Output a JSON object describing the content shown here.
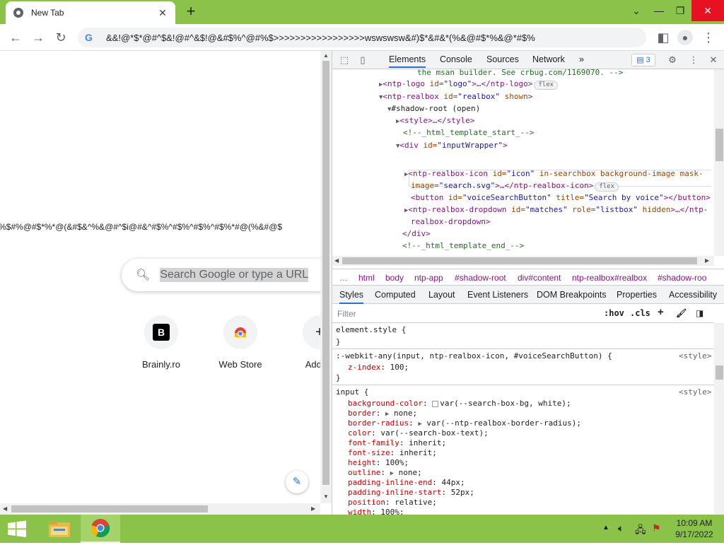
{
  "browser": {
    "tab_title": "New Tab",
    "url": "&&!@*$*@#^$&!@#^&$!@&#$%^@#%$>>>>>>>>>>>>>>>>>wswswsw&#)$*&#&*(%&@#$*%&@*#$%",
    "newtab_label": "+",
    "minimize": "⌄",
    "restore": "▭",
    "close": "✕",
    "maximize": "❐"
  },
  "page": {
    "gibberish_text": "%$#%@#$*%*@(&#$&^%&@#^$i@#&^#$%^#$%^#$%^#$%*#@(%&#@$",
    "search_placeholder": "Search Google or type a URL",
    "shortcuts": [
      {
        "label": "Brainly.ro",
        "glyph": "B"
      },
      {
        "label": "Web Store"
      },
      {
        "label": "Add sh"
      }
    ]
  },
  "devtools": {
    "tabs": [
      "Elements",
      "Console",
      "Sources",
      "Network",
      "»"
    ],
    "issues_count": "3",
    "dom_lines": {
      "l0": "the msan builder. See crbug.com/1169070. -->",
      "l1_tag": "<ntp-logo",
      "l1_attr": " id=",
      "l1_val": "\"logo\"",
      "l1_rest": ">…</ntp-logo>",
      "l1_badge": "flex",
      "l2_tag": "<ntp-realbox",
      "l2_attr": " id=",
      "l2_val": "\"realbox\"",
      "l2_attr2": " shown",
      "l2_end": ">",
      "l3": "#shadow-root (open)",
      "l4": "<style>…</style>",
      "l5": "<!--_html_template_start_-->",
      "l6_tag": "<div",
      "l6_attr": " id=",
      "l6_val": "\"inputWrapper\"",
      "l6_end": ">",
      "l7_tag": "<ntp-realbox-icon",
      "l7_attr": " id=",
      "l7_val": "\"icon\"",
      "l7_attr2": " in-searchbox background-image mask-",
      "l8_attr": "image=",
      "l8_val": "\"search.svg\"",
      "l8_rest": ">…</ntp-realbox-icon>",
      "l8_badge": "flex",
      "l9_tag": "<button",
      "l9_attr": " id=",
      "l9_val": "\"voiceSearchButton\"",
      "l9_attr2": " title=",
      "l9_val2": "\"Search by voice\"",
      "l9_end": "></button>",
      "l10_tag": "<ntp-realbox-dropdown",
      "l10_attr": " id=",
      "l10_val": "\"matches\"",
      "l10_attr2": " role=",
      "l10_val2": "\"listbox\"",
      "l10_attr3": " hidden",
      "l10_rest": ">…</ntp-",
      "l11": "realbox-dropdown>",
      "l12": "</div>",
      "l13": "<!--_html_template_end_-->"
    },
    "breadcrumbs": [
      "…",
      "html",
      "body",
      "ntp-app",
      "#shadow-root",
      "div#content",
      "ntp-realbox#realbox",
      "#shadow-roo"
    ],
    "style_tabs": [
      "Styles",
      "Computed",
      "Layout",
      "Event Listeners",
      "DOM Breakpoints",
      "Properties",
      "Accessibility"
    ],
    "filter_placeholder": "Filter",
    "hov": ":hov",
    "cls": ".cls",
    "plus": "+",
    "rules": {
      "r1_sel": "element.style {",
      "r1_end": "}",
      "r2_sel": ":-webkit-any(input, ntp-realbox-icon, #voiceSearchButton) {",
      "r2_src": "<style>",
      "r2_p1": "z-index",
      "r2_v1": "100;",
      "r2_end": "}",
      "r3_sel": "input {",
      "r3_src": "<style>",
      "props": [
        {
          "p": "background-color",
          "v": "var(--search-box-bg, white);"
        },
        {
          "p": "border",
          "v": "none;"
        },
        {
          "p": "border-radius",
          "v": "var(--ntp-realbox-border-radius);"
        },
        {
          "p": "color",
          "v": "var(--search-box-text);"
        },
        {
          "p": "font-family",
          "v": "inherit;"
        },
        {
          "p": "font-size",
          "v": "inherit;"
        },
        {
          "p": "height",
          "v": "100%;"
        },
        {
          "p": "outline",
          "v": "none;"
        },
        {
          "p": "padding-inline-end",
          "v": "44px;"
        },
        {
          "p": "padding-inline-start",
          "v": "52px;"
        },
        {
          "p": "position",
          "v": "relative;"
        },
        {
          "p": "width",
          "v": "100%;"
        }
      ]
    }
  },
  "taskbar": {
    "time": "10:09 AM",
    "date": "9/17/2022"
  },
  "colors": {
    "chrome_frame": "#8bc34a",
    "taskbar": "#8bc34a",
    "accent": "#1a73e8"
  }
}
